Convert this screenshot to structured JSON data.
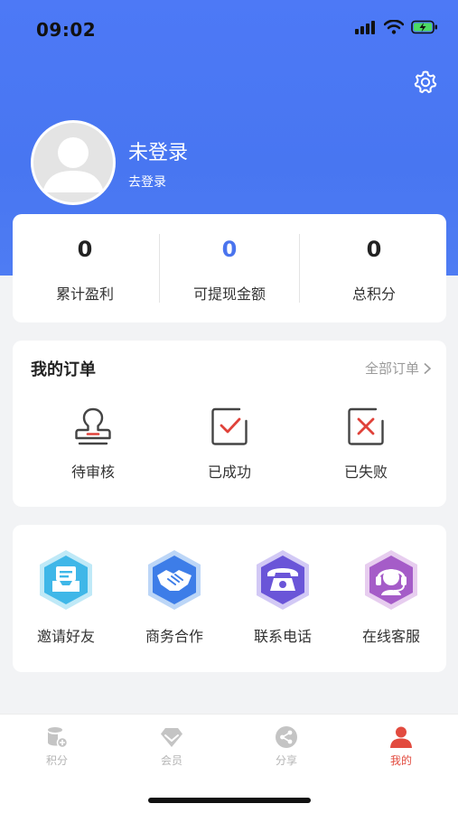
{
  "status_bar": {
    "time": "09:02"
  },
  "profile": {
    "username": "未登录",
    "login_link": "去登录"
  },
  "stats": [
    {
      "value": "0",
      "label": "累计盈利"
    },
    {
      "value": "0",
      "label": "可提现金额"
    },
    {
      "value": "0",
      "label": "总积分"
    }
  ],
  "orders": {
    "title": "我的订单",
    "all_orders": "全部订单",
    "items": [
      {
        "label": "待审核",
        "icon": "stamp-icon"
      },
      {
        "label": "已成功",
        "icon": "check-box-icon"
      },
      {
        "label": "已失败",
        "icon": "x-box-icon"
      }
    ]
  },
  "services": [
    {
      "label": "邀请好友",
      "icon": "inbox-icon",
      "color": "#3fb7e8"
    },
    {
      "label": "商务合作",
      "icon": "handshake-icon",
      "color": "#3d7de8"
    },
    {
      "label": "联系电话",
      "icon": "telephone-icon",
      "color": "#6a55d8"
    },
    {
      "label": "在线客服",
      "icon": "headset-agent-icon",
      "color": "#a55cc8"
    }
  ],
  "tabbar": [
    {
      "label": "积分",
      "icon": "database-icon",
      "active": false
    },
    {
      "label": "会员",
      "icon": "diamond-icon",
      "active": false
    },
    {
      "label": "分享",
      "icon": "share-icon",
      "active": false
    },
    {
      "label": "我的",
      "icon": "user-icon",
      "active": true
    }
  ],
  "colors": {
    "header": "#4d79f6",
    "accent_blue": "#4a74ee",
    "active_tab": "#e24b3f",
    "order_icon_red": "#e0423a"
  }
}
